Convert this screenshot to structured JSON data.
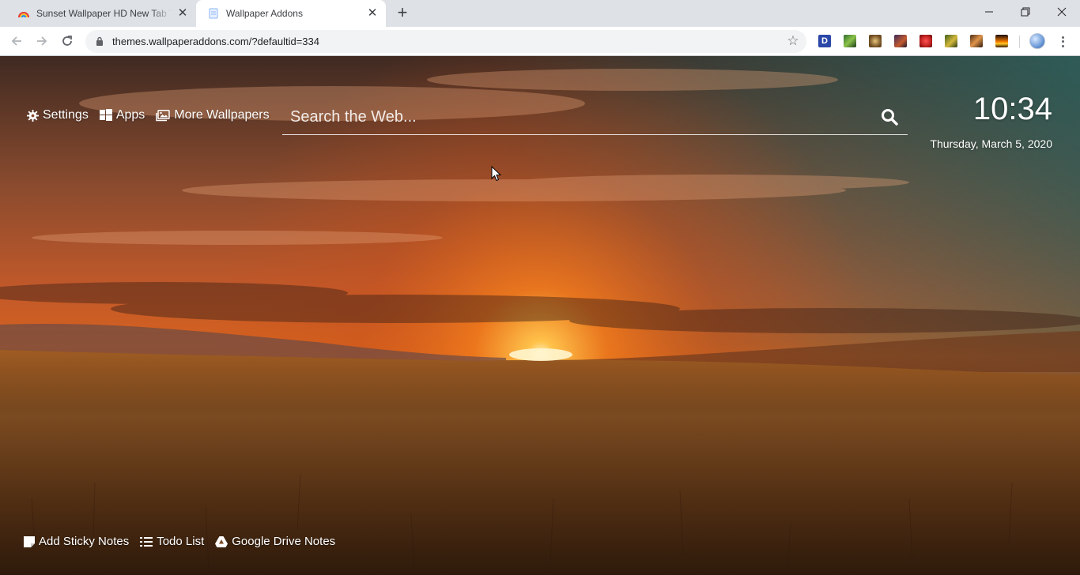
{
  "browser": {
    "tabs": [
      {
        "title": "Sunset Wallpaper HD New Tab Th",
        "active": false
      },
      {
        "title": "Wallpaper Addons",
        "active": true
      }
    ],
    "new_tab_symbol": "+",
    "address": "themes.wallpaperaddons.com/?defaultid=334",
    "extension_d_label": "D",
    "icons": [
      "back-icon",
      "forward-icon",
      "reload-icon",
      "lock-icon",
      "star-icon",
      "minimize-icon",
      "restore-icon",
      "close-icon",
      "menu-icon"
    ]
  },
  "topnav": {
    "settings": "Settings",
    "apps": "Apps",
    "more_wallpapers": "More Wallpapers"
  },
  "search": {
    "placeholder": "Search the Web..."
  },
  "clock": {
    "time": "10:34",
    "date": "Thursday, March 5, 2020"
  },
  "bottomnav": {
    "sticky": "Add Sticky Notes",
    "todo": "Todo List",
    "drive": "Google Drive Notes"
  },
  "colors": {
    "accent_sun": "#ffb347",
    "sky_teal": "#2e5e5a",
    "field_brown": "#5a3315"
  }
}
